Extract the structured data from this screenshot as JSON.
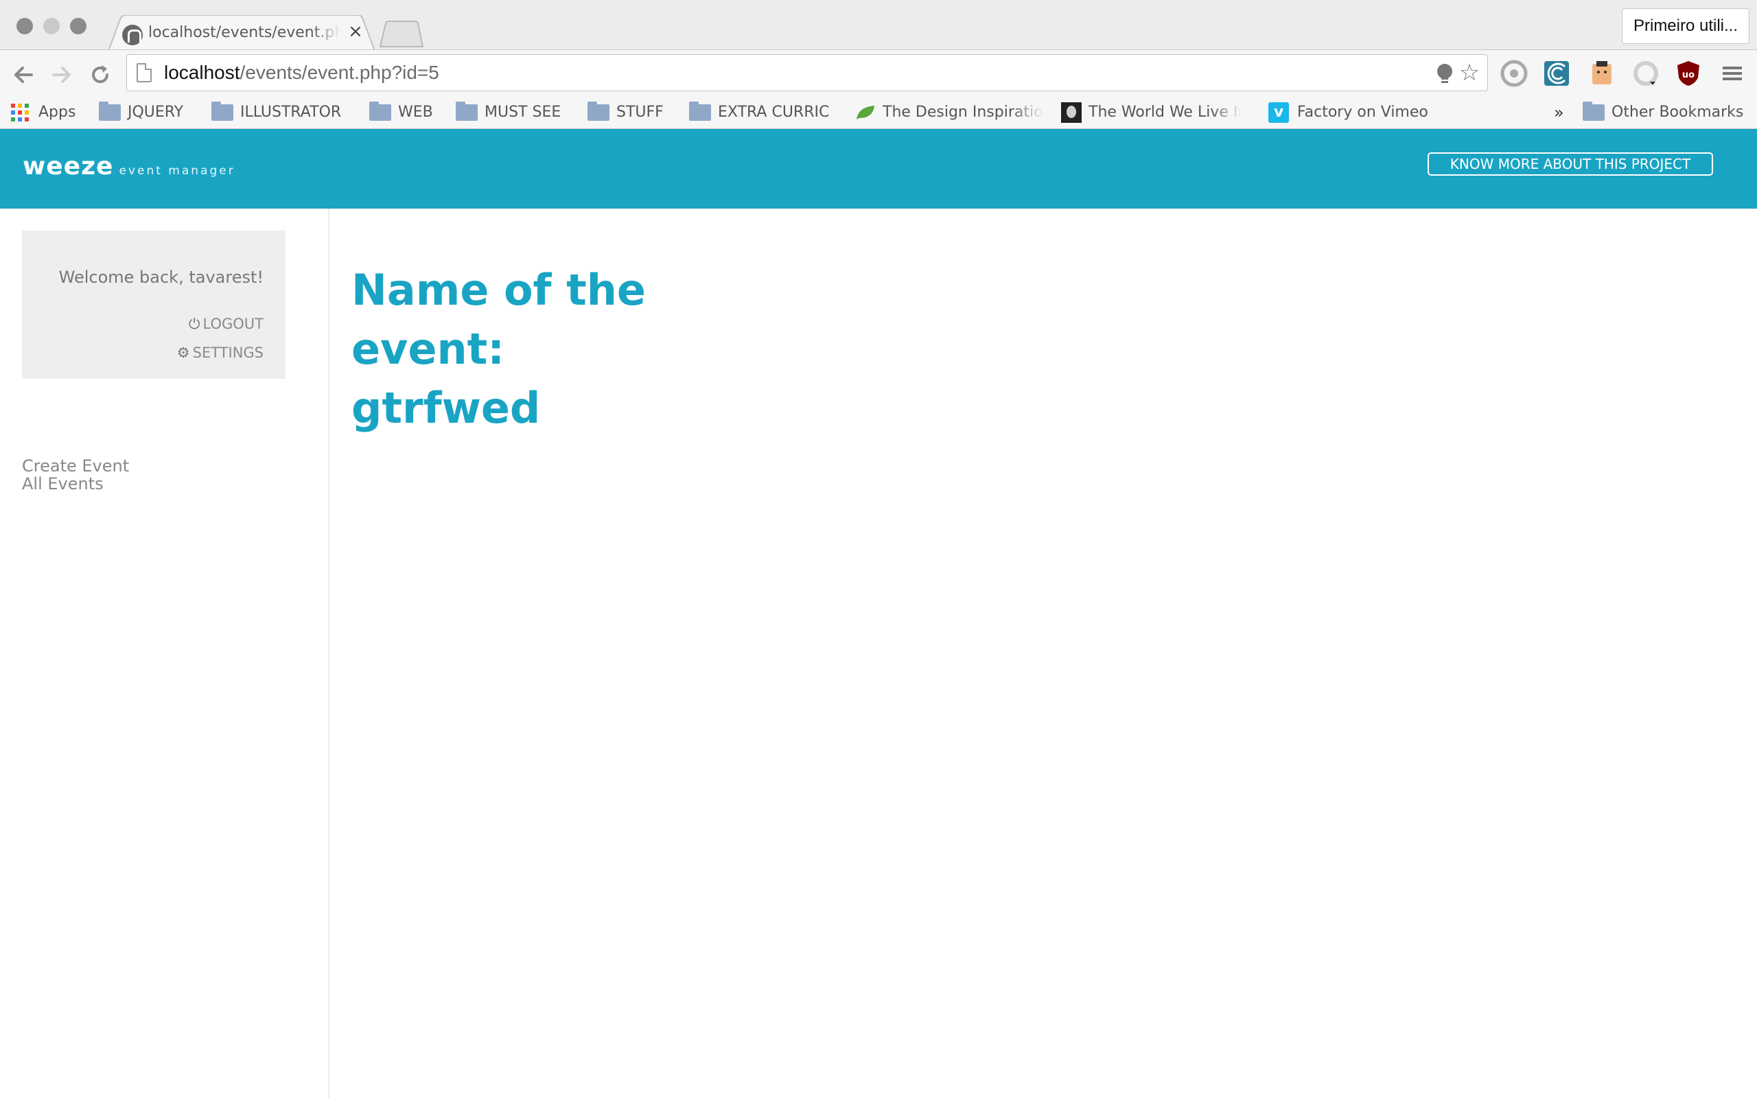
{
  "browser": {
    "tab": {
      "title": "localhost/events/event.php"
    },
    "profile_button": "Primeiro utili...",
    "url": {
      "host": "localhost",
      "path": "/events/event.php?id=5"
    },
    "bookmarks": [
      {
        "label": "Apps",
        "icon": "apps-grid-icon"
      },
      {
        "label": "JQUERY",
        "icon": "folder-icon"
      },
      {
        "label": "ILLUSTRATOR",
        "icon": "folder-icon"
      },
      {
        "label": "WEB",
        "icon": "folder-icon"
      },
      {
        "label": "MUST SEE",
        "icon": "folder-icon"
      },
      {
        "label": "STUFF",
        "icon": "folder-icon"
      },
      {
        "label": "EXTRA CURRIC",
        "icon": "folder-icon"
      },
      {
        "label": "The Design Inspiration",
        "icon": "leaf-icon"
      },
      {
        "label": "The World We Live In",
        "icon": "portrait-icon"
      },
      {
        "label": "Factory on Vimeo",
        "icon": "vimeo-icon"
      }
    ],
    "overflow": "»",
    "other_bookmarks": "Other Bookmarks"
  },
  "app": {
    "logo": {
      "main": "weeze",
      "sub": "event manager"
    },
    "know_more_button": "KNOW MORE ABOUT THIS PROJECT",
    "user_box": {
      "welcome": "Welcome back, tavarest!",
      "logout": "LOGOUT",
      "settings": "SETTINGS"
    },
    "menu": {
      "create": "Create Event",
      "all": "All Events"
    },
    "event_title": "Name of the event: gtrfwed"
  },
  "colors": {
    "brand": "#19a4c4",
    "sidebar_box": "#eeeeee"
  }
}
